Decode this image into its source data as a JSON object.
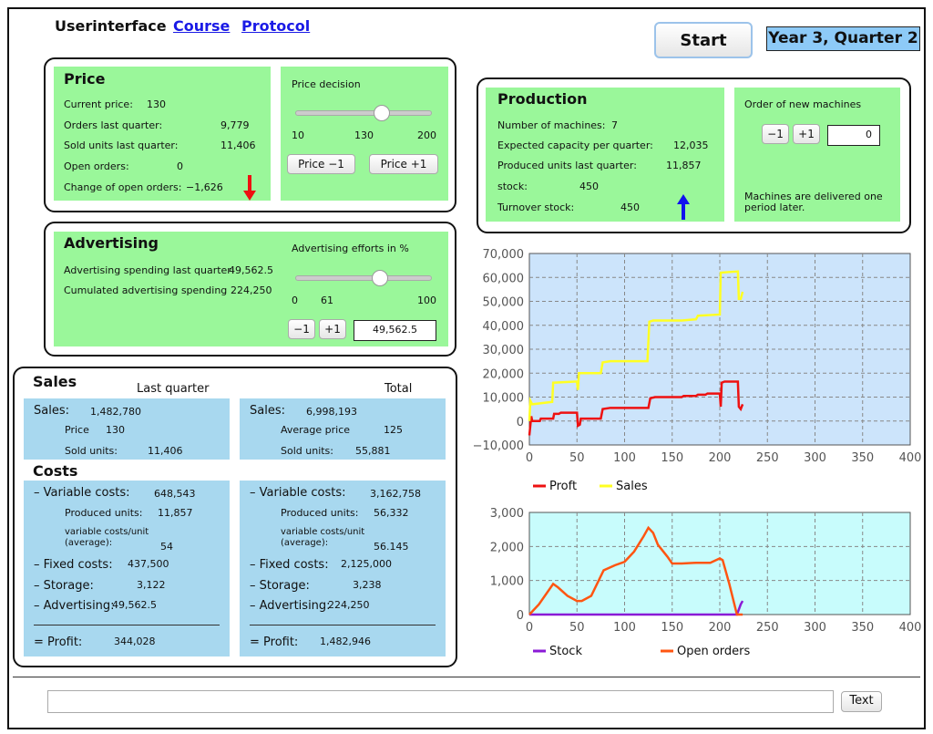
{
  "header": {
    "title": "Userinterface",
    "course": "Course",
    "protocol": "Protocol",
    "start": "Start",
    "period": "Year 3, Quarter 2"
  },
  "price": {
    "title": "Price",
    "current_label": "Current price:",
    "current": "130",
    "orders_label": "Orders last quarter:",
    "orders": "9,779",
    "sold_label": "Sold units last quarter:",
    "sold": "11,406",
    "open_label": "Open orders:",
    "open": "0",
    "change_label": "Change of open orders:",
    "change": "−1,626",
    "decision_label": "Price decision",
    "slider_min": "10",
    "slider_value": "130",
    "slider_max": "200",
    "slider_fraction": 0.63,
    "minus": "Price −1",
    "plus": "Price +1",
    "trend": "down",
    "trend_color": "#ee1111"
  },
  "advertising": {
    "title": "Advertising",
    "spend_label": "Advertising spending last quarter:",
    "spend": "49,562.5",
    "cum_label": "Cumulated advertising spending",
    "cum": "224,250",
    "efforts_label": "Advertising efforts in %",
    "slider_min": "0",
    "slider_value": "61",
    "slider_max": "100",
    "slider_fraction": 0.61,
    "minus": "−1",
    "plus": "+1",
    "input": "49,562.5"
  },
  "production": {
    "title": "Production",
    "machines_label": "Number of machines:",
    "machines": "7",
    "capacity_label": "Expected capacity per quarter:",
    "capacity": "12,035",
    "produced_label": "Produced units last quarter:",
    "produced": "11,857",
    "stock_label": "stock:",
    "stock": "450",
    "turnover_label": "Turnover stock:",
    "turnover": "450",
    "trend": "up",
    "trend_color": "#1111ee",
    "order_label": "Order of new machines",
    "minus": "−1",
    "plus": "+1",
    "order_input": "0",
    "note": "Machines are delivered one period later."
  },
  "sales": {
    "title": "Sales",
    "col_last": "Last quarter",
    "col_total": "Total",
    "costs_title": "Costs",
    "last": {
      "sales_label": "Sales:",
      "sales": "1,482,780",
      "price_label": "Price",
      "price": "130",
      "sold_label": "Sold units:",
      "sold": "11,406",
      "var_label": "– Variable costs:",
      "var": "648,543",
      "prod_label": "Produced units:",
      "prod": "11,857",
      "vcu_label1": "variable costs/unit",
      "vcu_label2": "(average):",
      "vcu": "54",
      "fixed_label": "– Fixed costs:",
      "fixed": "437,500",
      "storage_label": "– Storage:",
      "storage": "3,122",
      "adv_label": "– Advertising:",
      "adv": "49,562.5",
      "profit_label": "= Profit:",
      "profit": "344,028"
    },
    "total": {
      "sales_label": "Sales:",
      "sales": "6,998,193",
      "price_label": "Average price",
      "price": "125",
      "sold_label": "Sold units:",
      "sold": "55,881",
      "var_label": "– Variable costs:",
      "var": "3,162,758",
      "prod_label": "Produced units:",
      "prod": "56,332",
      "vcu_label1": "variable costs/unit",
      "vcu_label2": "(average):",
      "vcu": "56.145",
      "fixed_label": "– Fixed costs:",
      "fixed": "2,125,000",
      "storage_label": "– Storage:",
      "storage": "3,238",
      "adv_label": "– Advertising:",
      "adv": "224,250",
      "profit_label": "= Profit:",
      "profit": "1,482,946"
    }
  },
  "footer": {
    "input": "",
    "button": "Text"
  },
  "chart_data": [
    {
      "type": "line",
      "xlim": [
        0,
        400
      ],
      "ylim": [
        -10000,
        70000
      ],
      "xticks": [
        0,
        50,
        100,
        150,
        200,
        250,
        300,
        350,
        400
      ],
      "yticks": [
        -10000,
        0,
        10000,
        20000,
        30000,
        40000,
        50000,
        60000,
        70000
      ],
      "ytick_labels": [
        "−10,000",
        "0",
        "10,000",
        "20,000",
        "30,000",
        "40,000",
        "50,000",
        "60,000",
        "70,000"
      ],
      "grid": true,
      "background": "#cce4fb",
      "legend": "bottom-left",
      "series": [
        {
          "name": "Proft",
          "color": "#ee1111",
          "points": [
            [
              0,
              -6000
            ],
            [
              2,
              2000
            ],
            [
              3,
              0
            ],
            [
              11,
              0
            ],
            [
              12,
              1000
            ],
            [
              25,
              1000
            ],
            [
              26,
              3000
            ],
            [
              31,
              3000
            ],
            [
              33,
              3500
            ],
            [
              50,
              3500
            ],
            [
              51,
              -2000
            ],
            [
              53,
              -1500
            ],
            [
              54,
              1000
            ],
            [
              75,
              1000
            ],
            [
              77,
              5000
            ],
            [
              85,
              5500
            ],
            [
              125,
              5500
            ],
            [
              127,
              9500
            ],
            [
              132,
              10000
            ],
            [
              160,
              10000
            ],
            [
              162,
              10500
            ],
            [
              175,
              10500
            ],
            [
              177,
              11000
            ],
            [
              185,
              11000
            ],
            [
              187,
              11500
            ],
            [
              200,
              11500
            ],
            [
              201,
              6000
            ],
            [
              202,
              16000
            ],
            [
              205,
              16500
            ],
            [
              219,
              16500
            ],
            [
              220,
              6000
            ],
            [
              222,
              5000
            ],
            [
              224,
              7000
            ]
          ]
        },
        {
          "name": "Sales",
          "color": "#ffff22",
          "points": [
            [
              0,
              0
            ],
            [
              1,
              8500
            ],
            [
              3,
              7000
            ],
            [
              24,
              8000
            ],
            [
              25,
              16000
            ],
            [
              50,
              16500
            ],
            [
              51,
              13000
            ],
            [
              52,
              20000
            ],
            [
              75,
              20000
            ],
            [
              77,
              24500
            ],
            [
              85,
              25000
            ],
            [
              124,
              25000
            ],
            [
              126,
              41500
            ],
            [
              130,
              42000
            ],
            [
              160,
              42000
            ],
            [
              175,
              42500
            ],
            [
              177,
              44000
            ],
            [
              200,
              44500
            ],
            [
              201,
              62000
            ],
            [
              219,
              62500
            ],
            [
              220,
              51000
            ],
            [
              222,
              51000
            ],
            [
              224,
              54000
            ]
          ]
        }
      ]
    },
    {
      "type": "line",
      "xlim": [
        0,
        400
      ],
      "ylim": [
        0,
        3000
      ],
      "xticks": [
        0,
        50,
        100,
        150,
        200,
        250,
        300,
        350,
        400
      ],
      "yticks": [
        0,
        1000,
        2000,
        3000
      ],
      "ytick_labels": [
        "0",
        "1,000",
        "2,000",
        "3,000"
      ],
      "grid": true,
      "background": "#c8fcfc",
      "legend": "bottom",
      "series": [
        {
          "name": "Stock",
          "color": "#8a1ad6",
          "points": [
            [
              0,
              0
            ],
            [
              218,
              0
            ],
            [
              220,
              150
            ],
            [
              222,
              300
            ],
            [
              224,
              400
            ]
          ]
        },
        {
          "name": "Open orders",
          "color": "#ff5511",
          "points": [
            [
              0,
              0
            ],
            [
              10,
              300
            ],
            [
              25,
              900
            ],
            [
              30,
              800
            ],
            [
              40,
              550
            ],
            [
              50,
              400
            ],
            [
              55,
              400
            ],
            [
              65,
              550
            ],
            [
              78,
              1300
            ],
            [
              90,
              1450
            ],
            [
              100,
              1550
            ],
            [
              110,
              1850
            ],
            [
              120,
              2300
            ],
            [
              125,
              2550
            ],
            [
              130,
              2400
            ],
            [
              135,
              2050
            ],
            [
              145,
              1700
            ],
            [
              150,
              1500
            ],
            [
              160,
              1500
            ],
            [
              175,
              1520
            ],
            [
              190,
              1520
            ],
            [
              200,
              1650
            ],
            [
              203,
              1600
            ],
            [
              210,
              900
            ],
            [
              218,
              0
            ],
            [
              224,
              0
            ]
          ]
        }
      ]
    }
  ]
}
